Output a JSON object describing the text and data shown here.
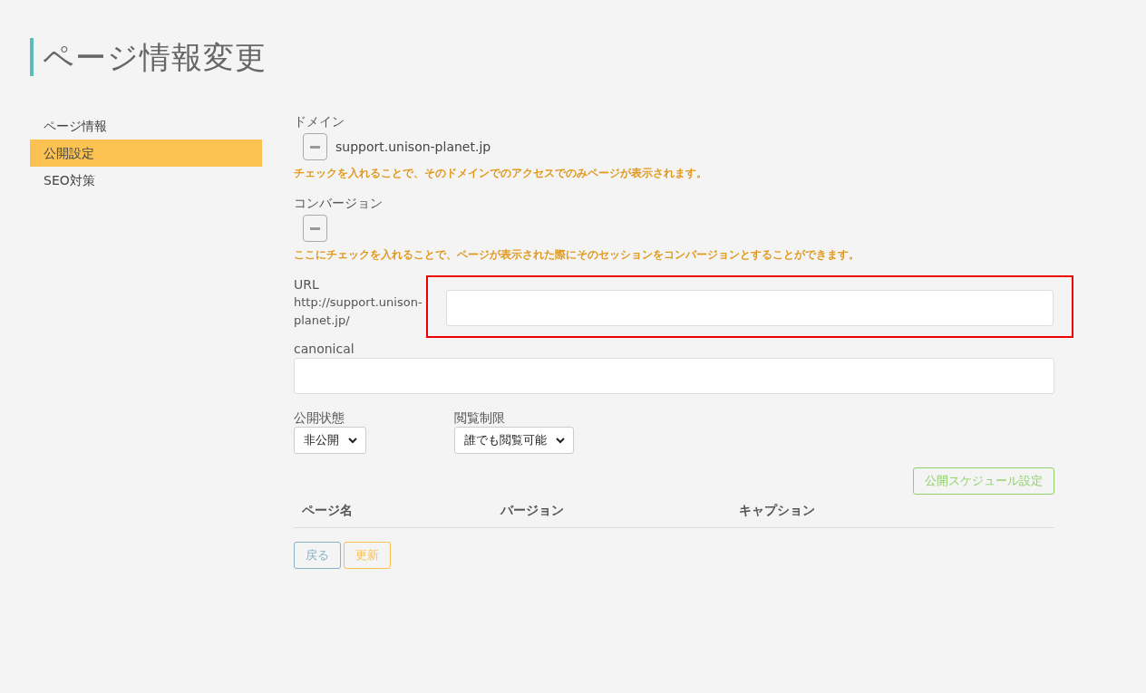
{
  "page_title": "ページ情報変更",
  "sidebar": {
    "items": [
      {
        "label": "ページ情報",
        "selected": false
      },
      {
        "label": "公開設定",
        "selected": true
      },
      {
        "label": "SEO対策",
        "selected": false
      }
    ]
  },
  "domain": {
    "label": "ドメイン",
    "checkbox": {
      "indeterminate": true,
      "label": "support.unison-planet.jp"
    },
    "hint": "チェックを入れることで、そのドメインでのアクセスでのみページが表示されます。"
  },
  "conversion": {
    "label": "コンバージョン",
    "checkbox": {
      "indeterminate": true
    },
    "hint": "ここにチェックを入れることで、ページが表示された際にそのセッションをコンバージョンとすることができます。"
  },
  "url": {
    "label": "URL",
    "prefix": "http://support.unison-planet.jp/",
    "highlighted": true
  },
  "canonical": {
    "label": "canonical"
  },
  "selects": [
    {
      "label": "公開状態",
      "value": "非公開"
    },
    {
      "label": "閲覧制限",
      "value": "誰でも閲覧可能"
    }
  ],
  "schedule_button": "公開スケジュール設定",
  "table": {
    "columns": [
      "ページ名",
      "バージョン",
      "キャプション"
    ]
  },
  "buttons": [
    {
      "kind": "back",
      "label": "戻る"
    },
    {
      "kind": "update",
      "label": "更新"
    }
  ]
}
